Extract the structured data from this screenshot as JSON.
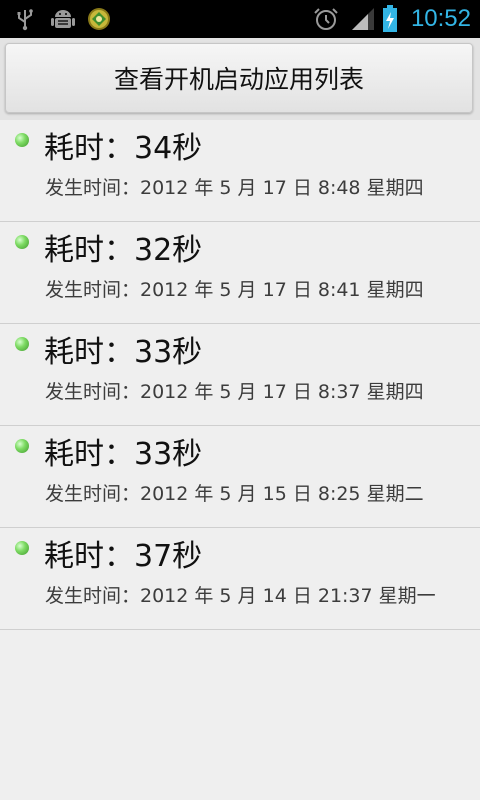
{
  "status_bar": {
    "time": "10:52",
    "time_color": "#33b5e5",
    "icons": [
      "usb-icon",
      "android-debug-icon",
      "app-notification-icon",
      "alarm-icon",
      "signal-icon",
      "battery-charging-icon"
    ]
  },
  "header": {
    "button_label": "查看开机启动应用列表"
  },
  "list": {
    "items": [
      {
        "title": "耗时：34秒",
        "subtitle": "发生时间：2012 年 5 月 17 日 8:48 星期四"
      },
      {
        "title": "耗时：32秒",
        "subtitle": "发生时间：2012 年 5 月 17 日 8:41 星期四"
      },
      {
        "title": "耗时：33秒",
        "subtitle": "发生时间：2012 年 5 月 17 日 8:37 星期四"
      },
      {
        "title": "耗时：33秒",
        "subtitle": "发生时间：2012 年 5 月 15 日 8:25 星期二"
      },
      {
        "title": "耗时：37秒",
        "subtitle": "发生时间：2012 年 5 月 14 日 21:37 星期一"
      }
    ]
  }
}
